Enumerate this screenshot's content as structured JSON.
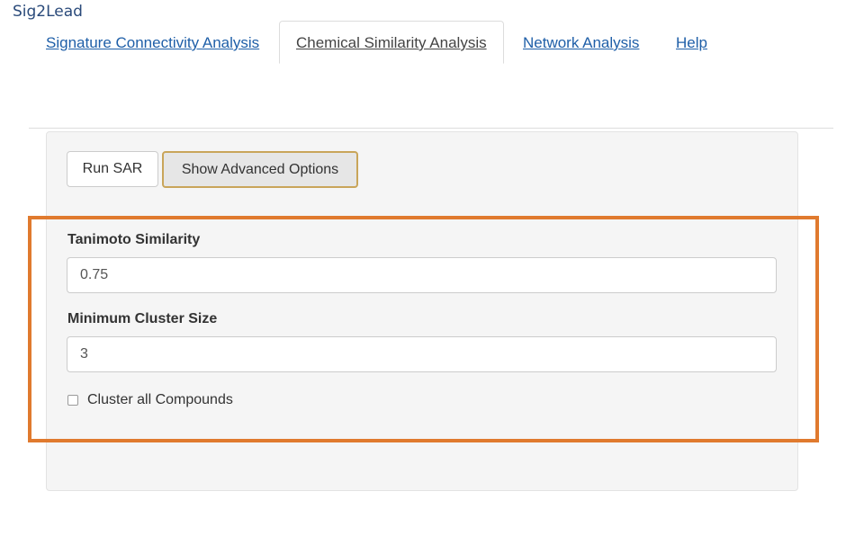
{
  "app": {
    "title": "Sig2Lead"
  },
  "tabs": [
    {
      "label": "Signature Connectivity Analysis",
      "active": false
    },
    {
      "label": "Chemical Similarity Analysis",
      "active": true
    },
    {
      "label": "Network Analysis",
      "active": false
    },
    {
      "label": "Help",
      "active": false
    }
  ],
  "panel": {
    "run_button_label": "Run SAR",
    "advanced_button_label": "Show Advanced Options",
    "tanimoto": {
      "label": "Tanimoto Similarity",
      "value": "0.75"
    },
    "min_cluster": {
      "label": "Minimum Cluster Size",
      "value": "3"
    },
    "cluster_all": {
      "label": "Cluster all Compounds",
      "checked": false
    }
  },
  "colors": {
    "highlight_border": "#e07a2e",
    "link": "#1f5fa8",
    "advanced_button_border": "#c9a55a"
  }
}
